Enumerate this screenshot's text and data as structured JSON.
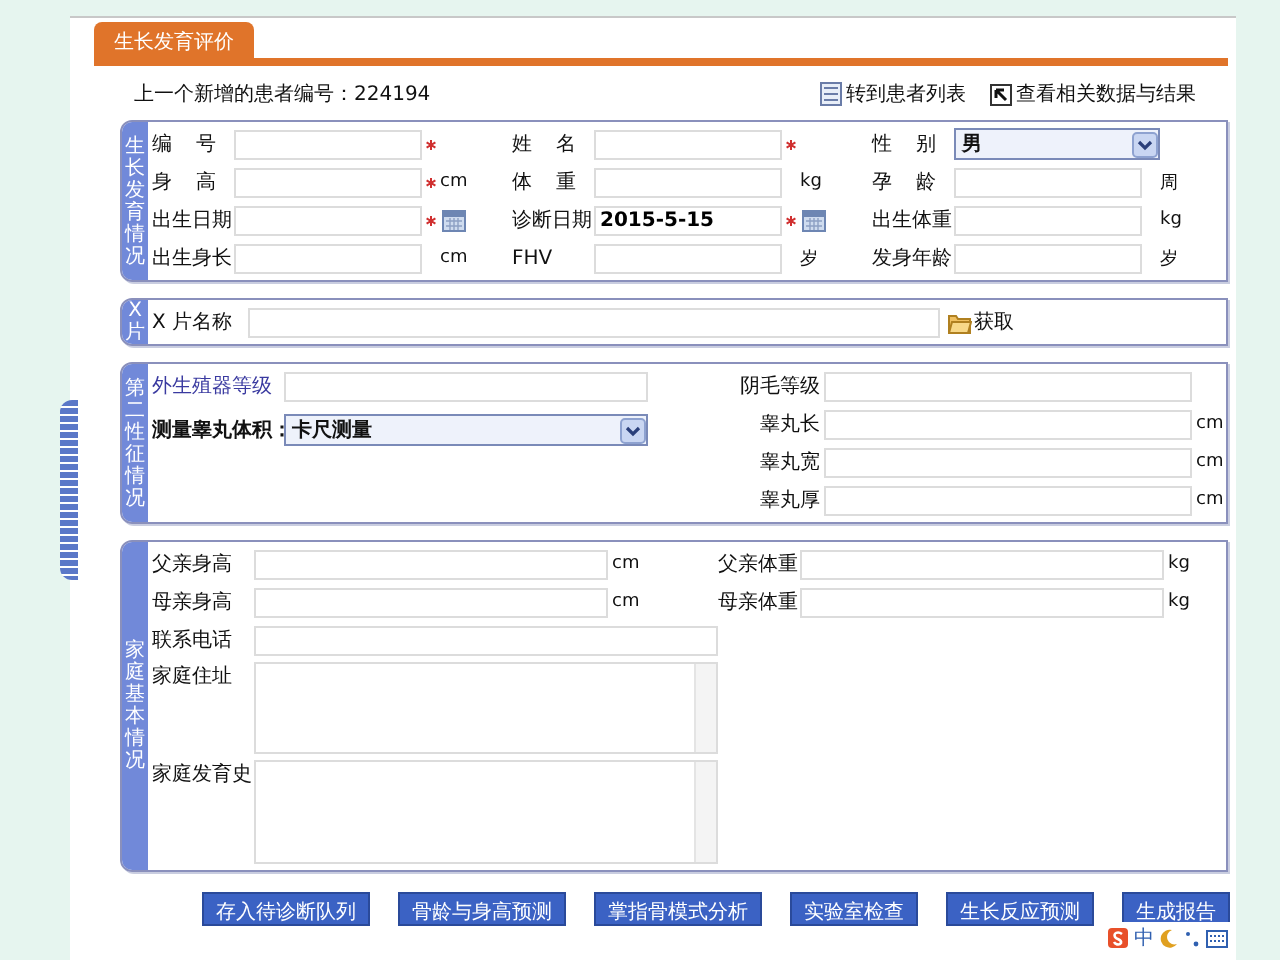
{
  "page_tab": {
    "title": "生长发育评价"
  },
  "info": {
    "text": "上一个新增的患者编号：224194"
  },
  "top_links": [
    {
      "kind": "list",
      "label": "转到患者列表"
    },
    {
      "kind": "arrow",
      "label": "查看相关数据与结果"
    }
  ],
  "sections": [
    {
      "title": "生长发育情况",
      "columns": [
        [
          {
            "label": "编号",
            "kind": "text",
            "required": true
          },
          {
            "label": "身高",
            "kind": "text",
            "required": true,
            "unit": "cm"
          },
          {
            "label": "出生日期",
            "kind": "date",
            "required": true
          },
          {
            "label": "出生身长",
            "kind": "text",
            "required": false,
            "unit": "cm"
          }
        ],
        [
          {
            "label": "姓名",
            "kind": "text",
            "required": true
          },
          {
            "label": "体重",
            "kind": "text",
            "required": false,
            "unit": "kg"
          },
          {
            "label": "诊断日期",
            "kind": "date",
            "required": true,
            "value": "2015-5-15"
          },
          {
            "label": "FHV",
            "kind": "text",
            "required": false,
            "unit": "岁"
          }
        ],
        [
          {
            "label": "性别",
            "kind": "select",
            "required": false,
            "value": "男"
          },
          {
            "label": "孕龄",
            "kind": "text",
            "required": false,
            "unit": "周"
          },
          {
            "label": "出生体重",
            "kind": "text",
            "required": false,
            "unit": "kg"
          },
          {
            "label": "发身年龄",
            "kind": "text",
            "required": false,
            "unit": "岁"
          }
        ]
      ]
    },
    {
      "title": "X片",
      "rows": [
        [
          {
            "label": "X 片名称",
            "kind": "fetch",
            "action": "获取"
          }
        ]
      ]
    },
    {
      "title": "第二性征情况",
      "columns": [
        [
          {
            "label": "外生殖器等级",
            "kind": "text"
          },
          {
            "label": "测量睾丸体积：",
            "kind": "select",
            "value": "卡尺测量"
          }
        ],
        [
          {
            "label": "阴毛等级",
            "kind": "text"
          },
          {
            "label": "睾丸长",
            "kind": "text",
            "unit": "cm"
          },
          {
            "label": "睾丸宽",
            "kind": "text",
            "unit": "cm"
          },
          {
            "label": "睾丸厚",
            "kind": "text",
            "unit": "cm"
          }
        ]
      ]
    },
    {
      "title": "家庭基本情况",
      "rows": [
        [
          {
            "label": "父亲身高",
            "kind": "text",
            "unit": "cm"
          },
          {
            "label": "父亲体重",
            "kind": "text",
            "unit": "kg"
          }
        ],
        [
          {
            "label": "母亲身高",
            "kind": "text",
            "unit": "cm"
          },
          {
            "label": "母亲体重",
            "kind": "text",
            "unit": "kg"
          }
        ],
        [
          {
            "label": "联系电话",
            "kind": "wide"
          }
        ],
        [
          {
            "label": "家庭住址",
            "kind": "textarea"
          }
        ],
        [
          {
            "label": "家庭发育史",
            "kind": "textarea"
          }
        ]
      ]
    }
  ],
  "buttons": [
    "存入待诊断队列",
    "骨龄与身高预测",
    "掌指骨模式分析",
    "实验室检查",
    "生长反应预测",
    "生成报告"
  ],
  "ime_toolbar": {
    "mode": "中"
  }
}
